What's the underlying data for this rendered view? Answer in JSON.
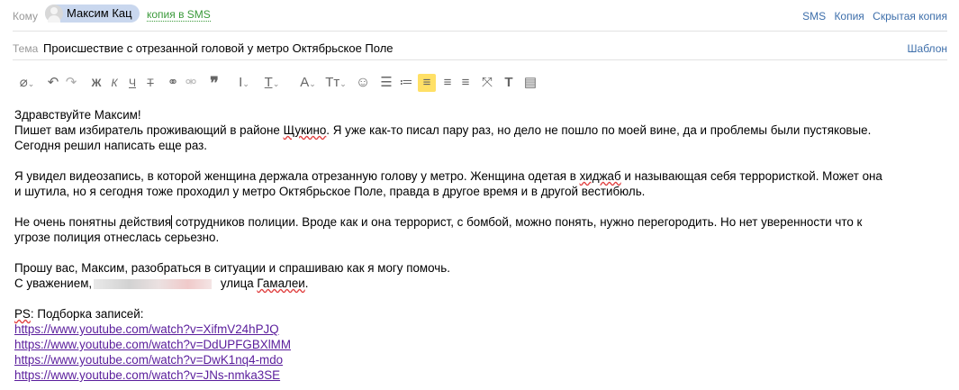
{
  "header": {
    "to_label": "Кому",
    "recipient": "Максим Кац",
    "sms_copy": "копия в SMS",
    "links": [
      "SMS",
      "Копия",
      "Скрытая копия"
    ]
  },
  "subject": {
    "label": "Тема",
    "value": "Происшествие с отрезанной головой у метро Октябрьское Поле",
    "template_link": "Шаблон"
  },
  "toolbar": {
    "icons": [
      "attach-icon",
      "undo-icon",
      "redo-icon",
      "bold-icon",
      "italic-icon",
      "underline-icon",
      "strikethrough-icon",
      "link-icon",
      "unlink-icon",
      "quote-icon",
      "text-format-icon",
      "text-color-icon",
      "font-size-icon",
      "text-case-icon",
      "emoji-icon",
      "ordered-list-icon",
      "unordered-list-icon",
      "align-left-icon",
      "align-center-icon",
      "align-right-icon",
      "fullscreen-icon",
      "clear-format-icon",
      "template-icon"
    ],
    "active": "align-left-icon",
    "active_color": "#ffe066"
  },
  "body": {
    "greeting": "Здравствуйте Максим!",
    "p1_a": "Пишет вам избиратель проживающий в районе ",
    "p1_word": "Щукино",
    "p1_b": ". Я уже как-то писал пару раз, но дело не пошло по моей вине, да и проблемы были пустяковые.",
    "p1_c": "Сегодня решил написать еще раз.",
    "p2_a": "Я увидел видеозапись, в которой женщина держала отрезанную голову у метро. Женщина одетая в ",
    "p2_word": "хиджаб",
    "p2_b": " и называющая себя террористкой. Может она",
    "p2_c": "и шутила, но я сегодня тоже проходил у метро Октябрьское Поле, правда в другое время и в другой вестибюль.",
    "p3_a": "Не очень понятны действия",
    "p3_b": " сотрудников полиции. Вроде как и она террорист, с бомбой, можно понять, нужно перегородить. Но нет уверенности что к",
    "p3_c": "угрозе полиция отнеслась серьезно.",
    "p4": "Прошу вас, Максим, разобраться в ситуации и спрашиваю как я могу помочь.",
    "sign_a": "С уважением,",
    "sign_b": " улица ",
    "sign_street": "Гамалеи",
    "sign_end": ".",
    "ps_word": "PS",
    "ps_rest": ": Подборка записей:",
    "links": [
      "https://www.youtube.com/watch?v=XifmV24hPJQ",
      "https://www.youtube.com/watch?v=DdUPFGBXlMM",
      "https://www.youtube.com/watch?v=DwK1nq4-mdo",
      "https://www.youtube.com/watch?v=JNs-nmka3SE"
    ]
  }
}
